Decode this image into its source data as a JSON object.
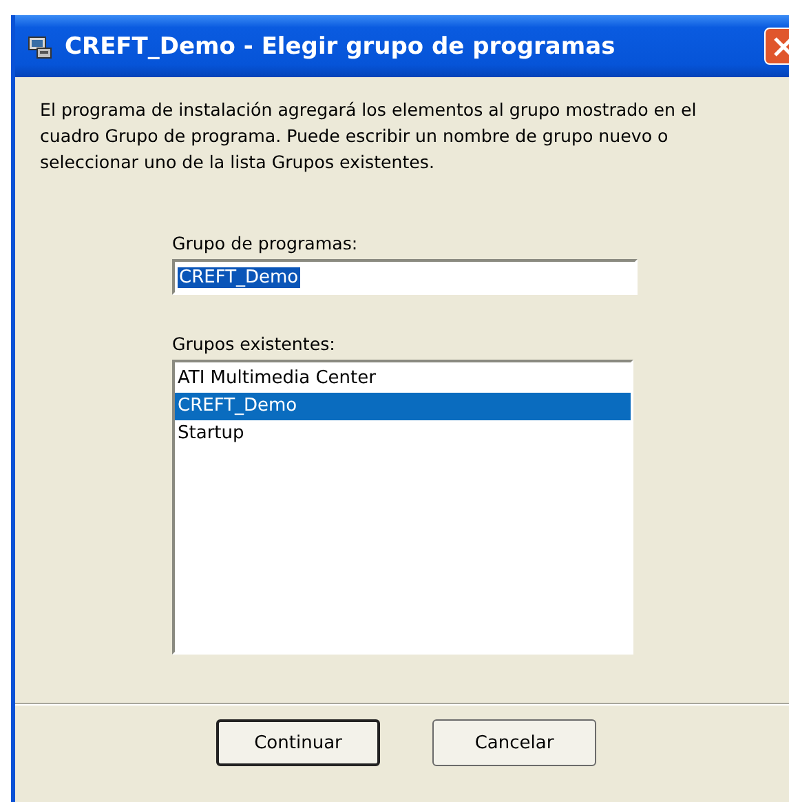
{
  "window": {
    "title": "CREFT_Demo - Elegir grupo de programas"
  },
  "intro": "El programa de instalación agregará los elementos al grupo mostrado en el cuadro Grupo de programa. Puede escribir un nombre de grupo nuevo o seleccionar uno de la lista Grupos existentes.",
  "group_field": {
    "label": "Grupo de programas:",
    "value": "CREFT_Demo",
    "value_selected": true
  },
  "existing_groups": {
    "label": "Grupos existentes:",
    "items": [
      {
        "label": "ATI Multimedia Center",
        "selected": false
      },
      {
        "label": "CREFT_Demo",
        "selected": true
      },
      {
        "label": "Startup",
        "selected": false
      }
    ]
  },
  "buttons": [
    {
      "label": "Continuar",
      "default": true
    },
    {
      "label": "Cancelar",
      "default": false
    }
  ]
}
